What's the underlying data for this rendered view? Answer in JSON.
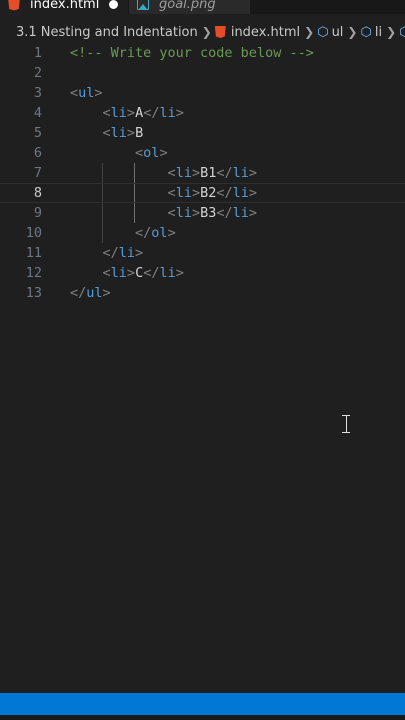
{
  "tabs": [
    {
      "label": "index.html",
      "icon": "html5-icon",
      "active": true,
      "dirty": true
    },
    {
      "label": "goal.png",
      "icon": "image-icon",
      "active": false
    }
  ],
  "breadcrumb": {
    "folder": "3.1 Nesting and Indentation",
    "file": "index.html",
    "symbols": [
      "ul",
      "li"
    ]
  },
  "editor": {
    "current_line": 8,
    "lines": [
      {
        "num": "1",
        "tokens": [
          {
            "t": "<!-- Write your code below -->",
            "c": "comment"
          }
        ]
      },
      {
        "num": "2",
        "tokens": []
      },
      {
        "num": "3",
        "tokens": [
          {
            "t": "<",
            "c": "bracket"
          },
          {
            "t": "ul",
            "c": "tag"
          },
          {
            "t": ">",
            "c": "bracket"
          }
        ]
      },
      {
        "num": "4",
        "tokens": [
          {
            "t": "    ",
            "c": "text"
          },
          {
            "t": "<",
            "c": "bracket"
          },
          {
            "t": "li",
            "c": "tag"
          },
          {
            "t": ">",
            "c": "bracket"
          },
          {
            "t": "A",
            "c": "text"
          },
          {
            "t": "</",
            "c": "bracket"
          },
          {
            "t": "li",
            "c": "tag"
          },
          {
            "t": ">",
            "c": "bracket"
          }
        ]
      },
      {
        "num": "5",
        "tokens": [
          {
            "t": "    ",
            "c": "text"
          },
          {
            "t": "<",
            "c": "bracket"
          },
          {
            "t": "li",
            "c": "tag"
          },
          {
            "t": ">",
            "c": "bracket"
          },
          {
            "t": "B",
            "c": "text"
          }
        ]
      },
      {
        "num": "6",
        "tokens": [
          {
            "t": "        ",
            "c": "text"
          },
          {
            "t": "<",
            "c": "bracket"
          },
          {
            "t": "ol",
            "c": "tag"
          },
          {
            "t": ">",
            "c": "bracket"
          }
        ]
      },
      {
        "num": "7",
        "tokens": [
          {
            "t": "            ",
            "c": "text"
          },
          {
            "t": "<",
            "c": "bracket"
          },
          {
            "t": "li",
            "c": "tag"
          },
          {
            "t": ">",
            "c": "bracket"
          },
          {
            "t": "B1",
            "c": "text"
          },
          {
            "t": "</",
            "c": "bracket"
          },
          {
            "t": "li",
            "c": "tag"
          },
          {
            "t": ">",
            "c": "bracket"
          }
        ]
      },
      {
        "num": "8",
        "tokens": [
          {
            "t": "            ",
            "c": "text"
          },
          {
            "t": "<",
            "c": "bracket"
          },
          {
            "t": "li",
            "c": "tag"
          },
          {
            "t": ">",
            "c": "bracket"
          },
          {
            "t": "B2",
            "c": "text"
          },
          {
            "t": "</",
            "c": "bracket"
          },
          {
            "t": "li",
            "c": "tag"
          },
          {
            "t": ">",
            "c": "bracket"
          }
        ]
      },
      {
        "num": "9",
        "tokens": [
          {
            "t": "            ",
            "c": "text"
          },
          {
            "t": "<",
            "c": "bracket"
          },
          {
            "t": "li",
            "c": "tag"
          },
          {
            "t": ">",
            "c": "bracket"
          },
          {
            "t": "B3",
            "c": "text"
          },
          {
            "t": "</",
            "c": "bracket"
          },
          {
            "t": "li",
            "c": "tag"
          },
          {
            "t": ">",
            "c": "bracket"
          }
        ]
      },
      {
        "num": "10",
        "tokens": [
          {
            "t": "        ",
            "c": "text"
          },
          {
            "t": "</",
            "c": "bracket"
          },
          {
            "t": "ol",
            "c": "tag"
          },
          {
            "t": ">",
            "c": "bracket"
          }
        ]
      },
      {
        "num": "11",
        "tokens": [
          {
            "t": "    ",
            "c": "text"
          },
          {
            "t": "</",
            "c": "bracket"
          },
          {
            "t": "li",
            "c": "tag"
          },
          {
            "t": ">",
            "c": "bracket"
          }
        ]
      },
      {
        "num": "12",
        "tokens": [
          {
            "t": "    ",
            "c": "text"
          },
          {
            "t": "<",
            "c": "bracket"
          },
          {
            "t": "li",
            "c": "tag"
          },
          {
            "t": ">",
            "c": "bracket"
          },
          {
            "t": "C",
            "c": "text"
          },
          {
            "t": "</",
            "c": "bracket"
          },
          {
            "t": "li",
            "c": "tag"
          },
          {
            "t": ">",
            "c": "bracket"
          }
        ]
      },
      {
        "num": "13",
        "tokens": [
          {
            "t": "</",
            "c": "bracket"
          },
          {
            "t": "ul",
            "c": "tag"
          },
          {
            "t": ">",
            "c": "bracket"
          }
        ]
      }
    ]
  },
  "colors": {
    "editor_bg": "#1f1f1f",
    "statusbar": "#0078d4",
    "comment": "#6a9955",
    "tag": "#569cd6",
    "bracket": "#808080",
    "text": "#d4d4d4"
  }
}
